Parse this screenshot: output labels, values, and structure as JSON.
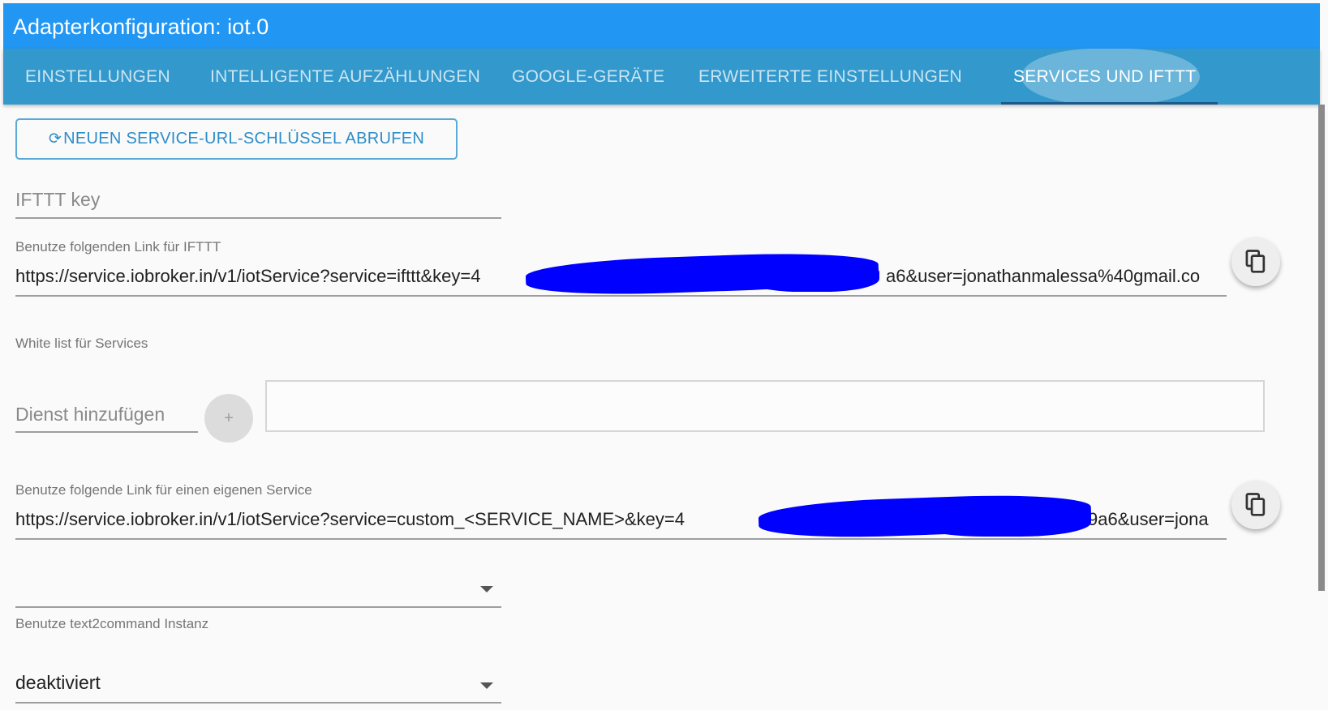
{
  "window": {
    "title": "Adapterkonfiguration: iot.0"
  },
  "tabs": [
    {
      "label": "EINSTELLUNGEN"
    },
    {
      "label": "INTELLIGENTE AUFZÄHLUNGEN"
    },
    {
      "label": "GOOGLE-GERÄTE"
    },
    {
      "label": "ERWEITERTE EINSTELLUNGEN"
    },
    {
      "label": "SERVICES UND IFTTT"
    }
  ],
  "active_tab": "SERVICES UND IFTTT",
  "new_key_button": {
    "label": "NEUEN SERVICE-URL-SCHLÜSSEL ABRUFEN"
  },
  "ifttt_key": {
    "placeholder": "IFTTT key",
    "value": ""
  },
  "ifttt_link": {
    "label": "Benutze folgenden Link für IFTTT",
    "value": "https://service.iobroker.in/v1/iotService?service=ifttt&key=4",
    "value_tail": "a6&user=jonathanmalessa%40gmail.co"
  },
  "whitelist": {
    "label": "White list für Services",
    "add_placeholder": "Dienst hinzufügen",
    "add_button": "+"
  },
  "custom_link": {
    "label": "Benutze folgende Link für einen eigenen Service",
    "value": "https://service.iobroker.in/v1/iotService?service=custom_<SERVICE_NAME>&key=4",
    "value_tail": "9a6&user=jona"
  },
  "text2command": {
    "label": "Benutze text2command Instanz",
    "value": ""
  },
  "deactivated_select": {
    "value": "deaktiviert"
  },
  "colors": {
    "header": "#2196f3",
    "tabs": "#3399cc",
    "accent": "#2d8dc9",
    "redaction": "#0000ff"
  },
  "icons": {
    "refresh": "refresh-icon",
    "copy": "copy-icon",
    "dropdown": "chevron-down-icon"
  }
}
